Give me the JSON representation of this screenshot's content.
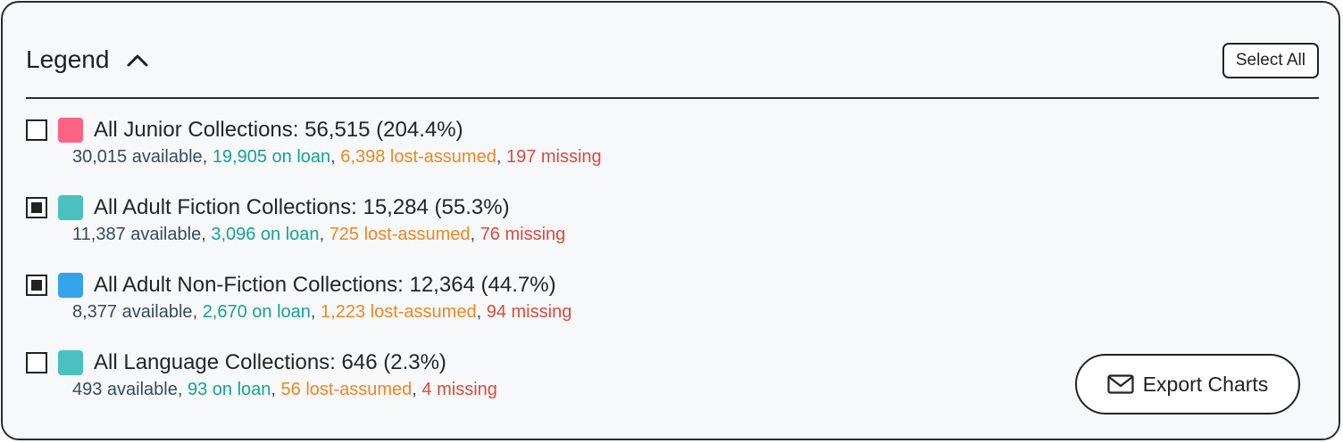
{
  "legend": {
    "title": "Legend",
    "select_all_label": "Select All",
    "collapse_icon": "chevron-up-icon"
  },
  "items": [
    {
      "label": "All Junior Collections: 56,515 (204.4%)",
      "checked": false,
      "color": "#ff6384",
      "available": "30,015 available",
      "on_loan": "19,905 on loan",
      "lost": "6,398 lost-assumed",
      "missing": "197 missing"
    },
    {
      "label": "All Adult Fiction Collections: 15,284 (55.3%)",
      "checked": true,
      "color": "#4bc0c0",
      "available": "11,387 available",
      "on_loan": "3,096 on loan",
      "lost": "725 lost-assumed",
      "missing": "76 missing"
    },
    {
      "label": "All Adult Non-Fiction Collections: 12,364 (44.7%)",
      "checked": true,
      "color": "#36a2eb",
      "available": "8,377 available",
      "on_loan": "2,670 on loan",
      "lost": "1,223 lost-assumed",
      "missing": "94 missing"
    },
    {
      "label": "All Language Collections: 646 (2.3%)",
      "checked": false,
      "color": "#4bc0c0",
      "available": "493 available",
      "on_loan": "93 on loan",
      "lost": "56 lost-assumed",
      "missing": "4 missing"
    }
  ],
  "separator": ", ",
  "export": {
    "label": "Export Charts",
    "icon": "envelope-icon"
  }
}
